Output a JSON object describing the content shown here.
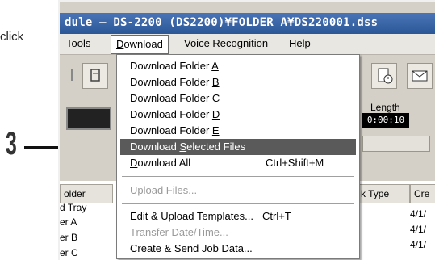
{
  "annotation": {
    "click_text": "click",
    "step_number": "3"
  },
  "window": {
    "title": "dule – DS-2200 (DS2200)¥FOLDER A¥DS220001.dss",
    "menus": [
      {
        "label": "Tools",
        "accel": "T",
        "rest": "ools"
      },
      {
        "label": "Download",
        "accel": "D",
        "rest": "ownload"
      },
      {
        "label": "Voice Recognition",
        "pre": "Voice Re",
        "accel": "c",
        "rest": "ognition"
      },
      {
        "label": "Help",
        "accel": "H",
        "rest": "elp"
      }
    ]
  },
  "player": {
    "length_label": "Length",
    "length_value": "0:00:10"
  },
  "table": {
    "headers": [
      "older",
      "k Type",
      "Cre"
    ],
    "folders": [
      "d Tray",
      "er A",
      "er B",
      "er C"
    ],
    "dates": [
      "4/1/",
      "4/1/",
      "4/1/"
    ]
  },
  "dropdown": {
    "items": [
      {
        "pre": "Download Folder ",
        "accel": "A",
        "post": "",
        "shortcut": ""
      },
      {
        "pre": "Download Folder ",
        "accel": "B",
        "post": "",
        "shortcut": ""
      },
      {
        "pre": "Download Folder ",
        "accel": "C",
        "post": "",
        "shortcut": ""
      },
      {
        "pre": "Download Folder ",
        "accel": "D",
        "post": "",
        "shortcut": ""
      },
      {
        "pre": "Download Folder ",
        "accel": "E",
        "post": "",
        "shortcut": ""
      },
      {
        "pre": "Download ",
        "accel": "S",
        "post": "elected Files",
        "shortcut": ""
      },
      {
        "pre": "",
        "accel": "D",
        "post": "ownload All",
        "shortcut": "Ctrl+Shift+M"
      },
      {
        "pre": "",
        "accel": "U",
        "post": "pload Files...",
        "shortcut": ""
      },
      {
        "pre": "Edit & Upload Templates...",
        "accel": "",
        "post": "",
        "shortcut": "Ctrl+T"
      },
      {
        "pre": "Transfer Date/Time...",
        "accel": "",
        "post": "",
        "shortcut": ""
      },
      {
        "pre": "Create & Send Job Data...",
        "accel": "",
        "post": "",
        "shortcut": ""
      }
    ]
  },
  "colors": {
    "highlight": "#5a5a5a",
    "titlebar": "#2b5797",
    "disabled": "#9a9a9a"
  }
}
